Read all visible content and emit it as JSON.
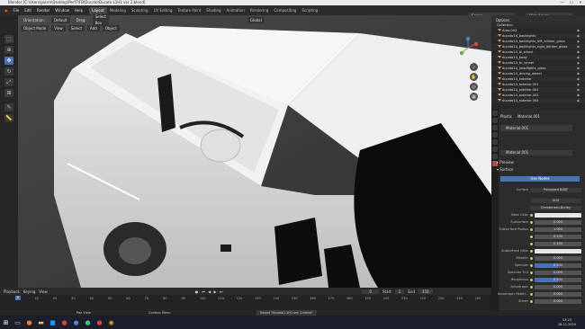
{
  "window": {
    "title": "Blender [C:\\Users\\pierre\\Desktop\\Perf7\\FB\\Ducato\\Ducato L1H1 ver 2.blend]"
  },
  "menu": [
    "File",
    "Edit",
    "Render",
    "Window",
    "Help"
  ],
  "workspaces": [
    {
      "label": "Layout",
      "active": true
    },
    {
      "label": "Modeling"
    },
    {
      "label": "Sculpting"
    },
    {
      "label": "UV Editing"
    },
    {
      "label": "Texture Paint"
    },
    {
      "label": "Shading"
    },
    {
      "label": "Animation"
    },
    {
      "label": "Rendering"
    },
    {
      "label": "Compositing"
    },
    {
      "label": "Scripting"
    }
  ],
  "scene": {
    "label": "Scene",
    "view_layer": "View Layer"
  },
  "viewport": {
    "orientation_label": "Orientation:",
    "orientation_value": "Default",
    "drag_label": "Drag:",
    "drag_value": "Select Box",
    "mode": "Object Mode",
    "menus": [
      "View",
      "Select",
      "Add",
      "Object"
    ],
    "transform": "Global",
    "options": "Options"
  },
  "outliner": {
    "title": "Collection",
    "items": [
      "Area.003",
      "ducato14_backlights",
      "ducato14_backlights_left_blinker_glass",
      "ducato14_backlights_right_blinker_glass",
      "ducato14_bl_wheel",
      "ducato14_body",
      "ducato14_br_wheel",
      "ducato14_headlights_glass",
      "ducato14_driving_wheel",
      "ducato14_exterior",
      "ducato14_exterior.001",
      "ducato14_exterior.002",
      "ducato14_exterior.003",
      "ducato14_exterior.004"
    ]
  },
  "properties": {
    "object": "Plastic",
    "material": "Material.001",
    "slot": "Material.001",
    "mat_name": "Material.001",
    "preview": "Preview",
    "surface": "Surface",
    "use_nodes": "Use Nodes",
    "surface_label": "Surface",
    "surface_value": "Principled BSDF",
    "dist": "GGX",
    "sss_method": "Christensen-Burley",
    "rows": [
      {
        "label": "Base Color",
        "value": "",
        "kind": "color"
      },
      {
        "label": "Subsurface",
        "value": "0.000"
      },
      {
        "label": "Subsurface Radius",
        "value": "1.000"
      },
      {
        "label": "",
        "value": "0.200"
      },
      {
        "label": "",
        "value": "0.100"
      },
      {
        "label": "Subsurface Color",
        "value": "",
        "kind": "color"
      },
      {
        "label": "Metallic",
        "value": "0.000"
      },
      {
        "label": "Specular",
        "value": "0.500",
        "fill": 0.5
      },
      {
        "label": "Specular Tint",
        "value": "0.000"
      },
      {
        "label": "Roughness",
        "value": "0.500",
        "fill": 0.5
      },
      {
        "label": "Anisotropic",
        "value": "0.000"
      },
      {
        "label": "Anisotropic Rotati...",
        "value": "0.000"
      },
      {
        "label": "Sheen",
        "value": "0.000"
      }
    ]
  },
  "timeline": {
    "menus": [
      "Playback",
      "Keying",
      "View"
    ],
    "current_frame": "0",
    "start_label": "Start",
    "start": "1",
    "end_label": "End",
    "end": "250",
    "ticks": [
      "0",
      "10",
      "20",
      "30",
      "40",
      "50",
      "60",
      "70",
      "80",
      "90",
      "100",
      "110",
      "120",
      "130",
      "140",
      "150",
      "160",
      "170",
      "180",
      "190",
      "200",
      "210",
      "220",
      "230",
      "240",
      "250"
    ]
  },
  "status": {
    "left": "Pan View",
    "mid": "Context Menu",
    "msg": "Saved \"Ducato L1H1 ver 2.blend\""
  },
  "taskbar": {
    "time": "13:23",
    "date": "28.11.2020"
  }
}
